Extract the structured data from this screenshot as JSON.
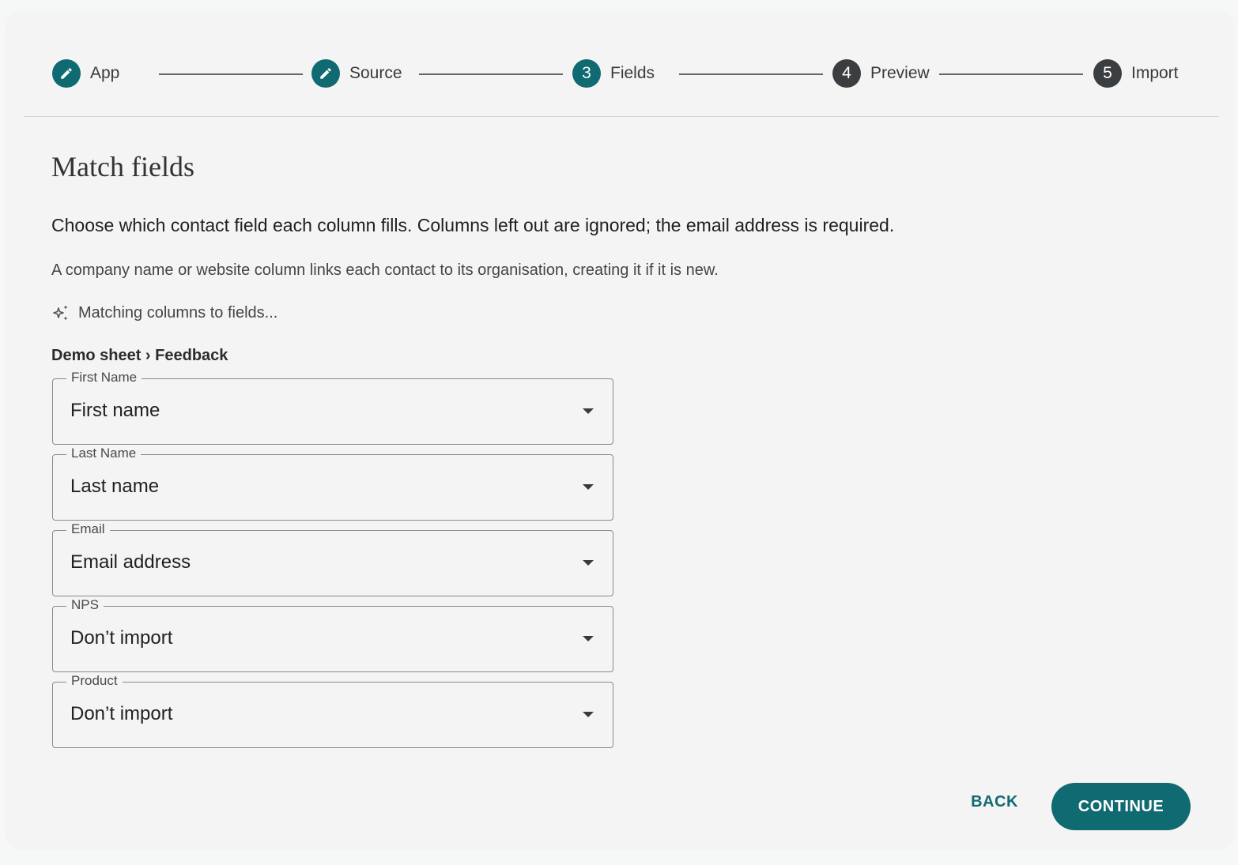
{
  "stepper": {
    "steps": [
      {
        "label": "App",
        "indicator": "pencil-icon",
        "state": "done"
      },
      {
        "label": "Source",
        "indicator": "pencil-icon",
        "state": "done"
      },
      {
        "label": "Fields",
        "number": "3",
        "state": "active"
      },
      {
        "label": "Preview",
        "number": "4",
        "state": "todo"
      },
      {
        "label": "Import",
        "number": "5",
        "state": "todo"
      }
    ]
  },
  "main": {
    "title": "Match fields",
    "lead": "Choose which contact field each column fills. Columns left out are ignored; the email address is required.",
    "sub": "A company name or website column links each contact to its organisation, creating it if it is new.",
    "matching_status": "Matching columns to fields...",
    "breadcrumb": "Demo sheet › Feedback",
    "fields": [
      {
        "label": "First Name",
        "value": "First name"
      },
      {
        "label": "Last Name",
        "value": "Last name"
      },
      {
        "label": "Email",
        "value": "Email address"
      },
      {
        "label": "NPS",
        "value": "Don’t import"
      },
      {
        "label": "Product",
        "value": "Don’t import"
      }
    ]
  },
  "actions": {
    "back_label": "BACK",
    "continue_label": "CONTINUE"
  },
  "colors": {
    "accent": "#106a72",
    "inactive_step": "#3b3e40",
    "background": "#f4f4f4"
  }
}
